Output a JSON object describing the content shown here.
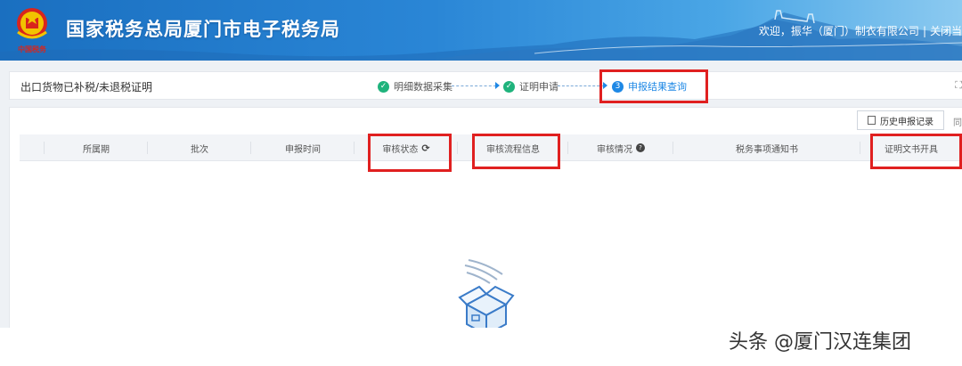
{
  "header": {
    "site_title": "国家税务总局厦门市电子税务局",
    "welcome_text": "欢迎，振华（厦门）制衣有限公司",
    "separator": "|",
    "close_link": "关闭当",
    "emblem_icon": "tax-emblem-icon",
    "brand_color": "#1a6fc0"
  },
  "stepbar": {
    "page_name": "出口货物已补税/未退税证明",
    "steps": [
      {
        "label": "明细数据采集",
        "status": "done",
        "icon": "check-circle-icon"
      },
      {
        "label": "证明申请",
        "status": "done",
        "icon": "check-circle-icon"
      },
      {
        "number": "3",
        "label": "申报结果查询",
        "status": "current"
      }
    ],
    "expand_icon": "fullscreen-icon"
  },
  "toolbar": {
    "history_button": "历史申报记录",
    "more_text": "同"
  },
  "table": {
    "columns": [
      "所属期",
      "批次",
      "申报时间",
      "审核状态",
      "审核流程信息",
      "审核情况",
      "税务事项通知书",
      "证明文书开具"
    ],
    "refresh_icon": "refresh-icon",
    "help_icon": "question-circle-icon",
    "rows": []
  },
  "empty_state": {
    "icon": "empty-box-icon"
  },
  "watermark": {
    "text": "头条 @厦门汉连集团"
  },
  "colors": {
    "step_done": "#1fb37c",
    "step_current": "#1e88e5",
    "highlight": "#e02020"
  }
}
